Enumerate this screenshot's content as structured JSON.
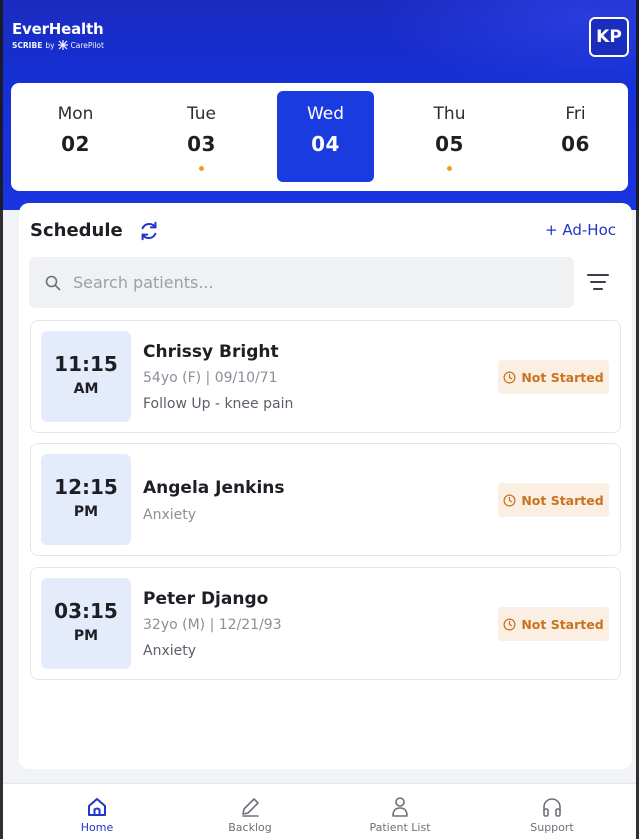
{
  "brand": {
    "name": "EverHealth",
    "product": "SCRIBE",
    "by": "by",
    "partner": "CarePilot"
  },
  "user": {
    "initials": "KP"
  },
  "week": [
    {
      "day": "Mon",
      "date": "02",
      "selected": false,
      "has_dot": false
    },
    {
      "day": "Tue",
      "date": "03",
      "selected": false,
      "has_dot": true
    },
    {
      "day": "Wed",
      "date": "04",
      "selected": true,
      "has_dot": false
    },
    {
      "day": "Thu",
      "date": "05",
      "selected": false,
      "has_dot": true
    },
    {
      "day": "Fri",
      "date": "06",
      "selected": false,
      "has_dot": false
    }
  ],
  "schedule": {
    "title": "Schedule",
    "adhoc_label": "+ Ad-Hoc",
    "search_placeholder": "Search patients..."
  },
  "appointments": [
    {
      "time": "11:15",
      "ampm": "AM",
      "name": "Chrissy Bright",
      "meta": "54yo (F) | 09/10/71",
      "reason": "Follow Up -  knee pain",
      "status": "Not Started"
    },
    {
      "time": "12:15",
      "ampm": "PM",
      "name": "Angela Jenkins",
      "meta": "",
      "reason": "Anxiety",
      "status": "Not Started"
    },
    {
      "time": "03:15",
      "ampm": "PM",
      "name": "Peter Django",
      "meta": "32yo (M) | 12/21/93",
      "reason": "Anxiety",
      "status": "Not Started"
    }
  ],
  "nav": [
    {
      "label": "Home",
      "icon": "home-icon",
      "active": true
    },
    {
      "label": "Backlog",
      "icon": "pencil-icon",
      "active": false
    },
    {
      "label": "Patient List",
      "icon": "person-icon",
      "active": false
    },
    {
      "label": "Support",
      "icon": "headphones-icon",
      "active": false
    }
  ],
  "colors": {
    "primary": "#1a3be0",
    "status_bg": "#fbeee2",
    "status_fg": "#c8741e",
    "dot": "#f0a020"
  }
}
